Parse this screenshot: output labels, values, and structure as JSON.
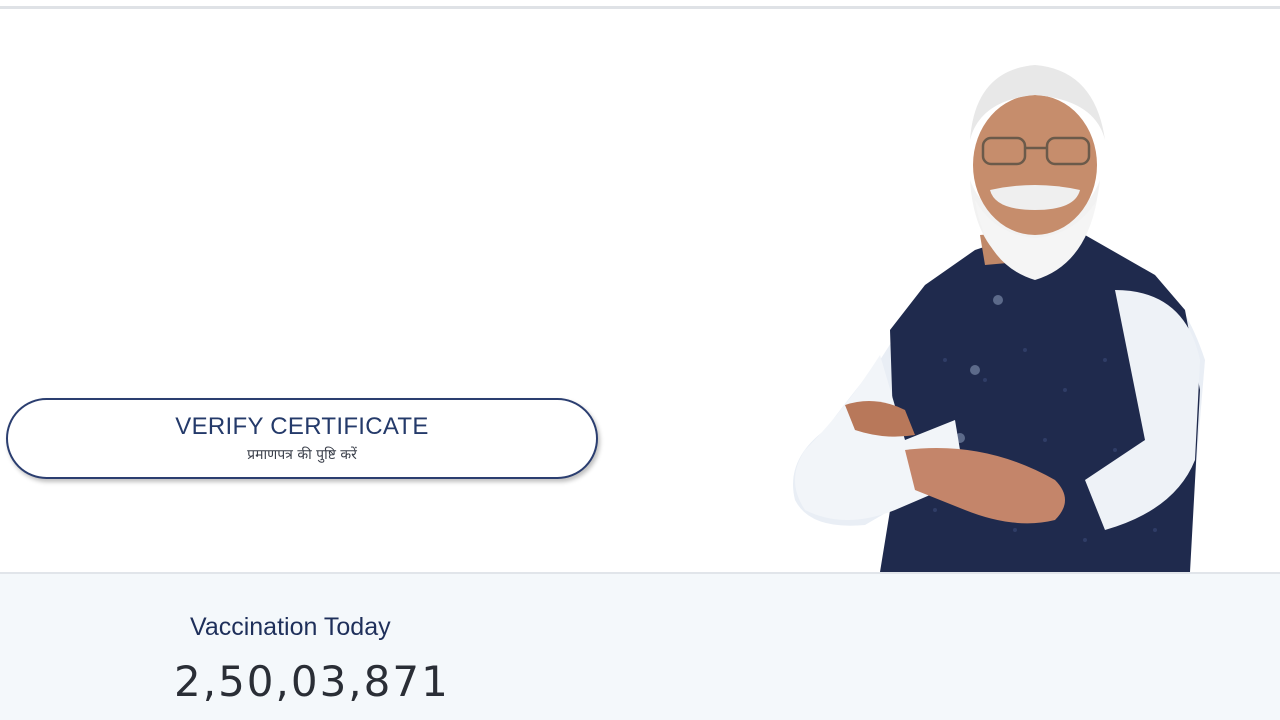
{
  "verify": {
    "title": "VERIFY CERTIFICATE",
    "subtitle": "प्रमाणपत्र की पुष्टि करें"
  },
  "stats": {
    "label": "Vaccination Today",
    "count": "2,50,03,871"
  },
  "colors": {
    "accent_navy": "#243a6a",
    "band_bg": "#f4f8fb",
    "vest": "#1f2a4d"
  },
  "portrait": {
    "icon": "person-portrait-icon"
  }
}
